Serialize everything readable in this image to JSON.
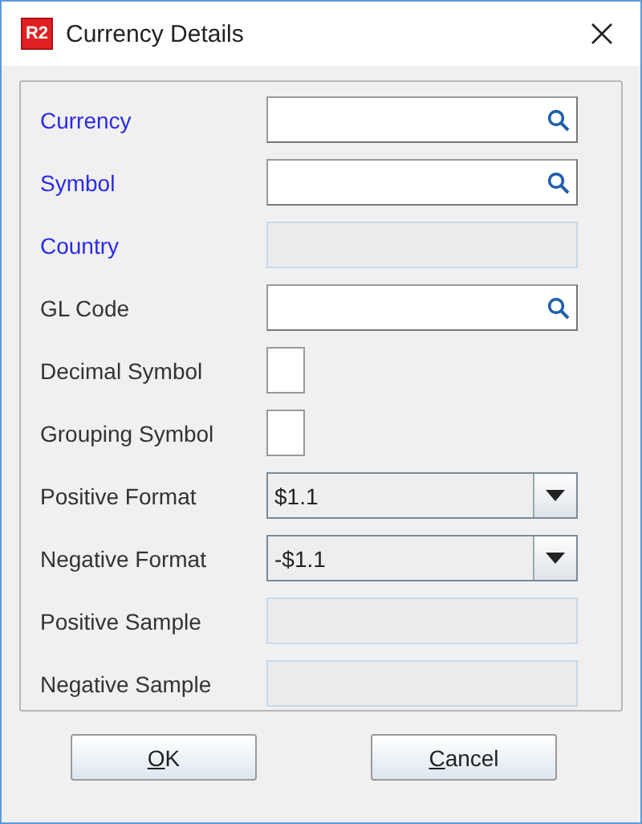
{
  "window": {
    "title": "Currency Details",
    "logo": "R2"
  },
  "fields": [
    {
      "label": "Currency",
      "required": true,
      "kind": "lookup"
    },
    {
      "label": "Symbol",
      "required": true,
      "kind": "lookup"
    },
    {
      "label": "Country",
      "required": true,
      "kind": "readonly"
    },
    {
      "label": "GL Code",
      "required": false,
      "kind": "lookup"
    },
    {
      "label": "Decimal Symbol",
      "required": false,
      "kind": "char"
    },
    {
      "label": "Grouping Symbol",
      "required": false,
      "kind": "char"
    },
    {
      "label": "Positive Format",
      "required": false,
      "kind": "combo",
      "value": "$1.1"
    },
    {
      "label": "Negative Format",
      "required": false,
      "kind": "combo",
      "value": "-$1.1"
    },
    {
      "label": "Positive Sample",
      "required": false,
      "kind": "readonly"
    },
    {
      "label": "Negative Sample",
      "required": false,
      "kind": "readonly"
    }
  ],
  "buttons": [
    {
      "label": "OK",
      "underline_first": true
    },
    {
      "label": "Cancel",
      "underline_first": true
    }
  ]
}
